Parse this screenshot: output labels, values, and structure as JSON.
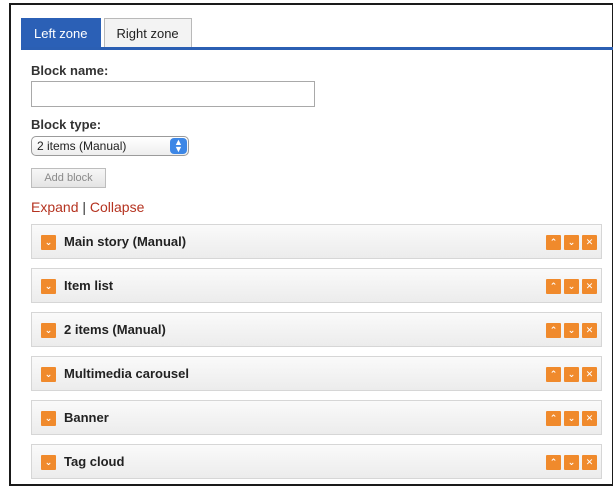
{
  "tabs": [
    {
      "label": "Left zone",
      "active": true
    },
    {
      "label": "Right zone",
      "active": false
    }
  ],
  "form": {
    "block_name_label": "Block name:",
    "block_name_value": "",
    "block_type_label": "Block type:",
    "block_type_selected": "2 items (Manual)",
    "add_button_label": "Add block"
  },
  "controls": {
    "expand_label": "Expand",
    "separator": "|",
    "collapse_label": "Collapse"
  },
  "blocks": [
    {
      "title": "Main story (Manual)"
    },
    {
      "title": "Item list"
    },
    {
      "title": "2 items (Manual)"
    },
    {
      "title": "Multimedia carousel"
    },
    {
      "title": "Banner"
    },
    {
      "title": "Tag cloud"
    }
  ],
  "icons": {
    "toggle": "chevron-down-icon",
    "move_up": "arrow-up-icon",
    "move_down": "arrow-down-icon",
    "remove": "close-icon"
  },
  "colors": {
    "tab_active": "#2b60b6",
    "accent_orange": "#f08a2c",
    "link_red": "#b53320"
  }
}
